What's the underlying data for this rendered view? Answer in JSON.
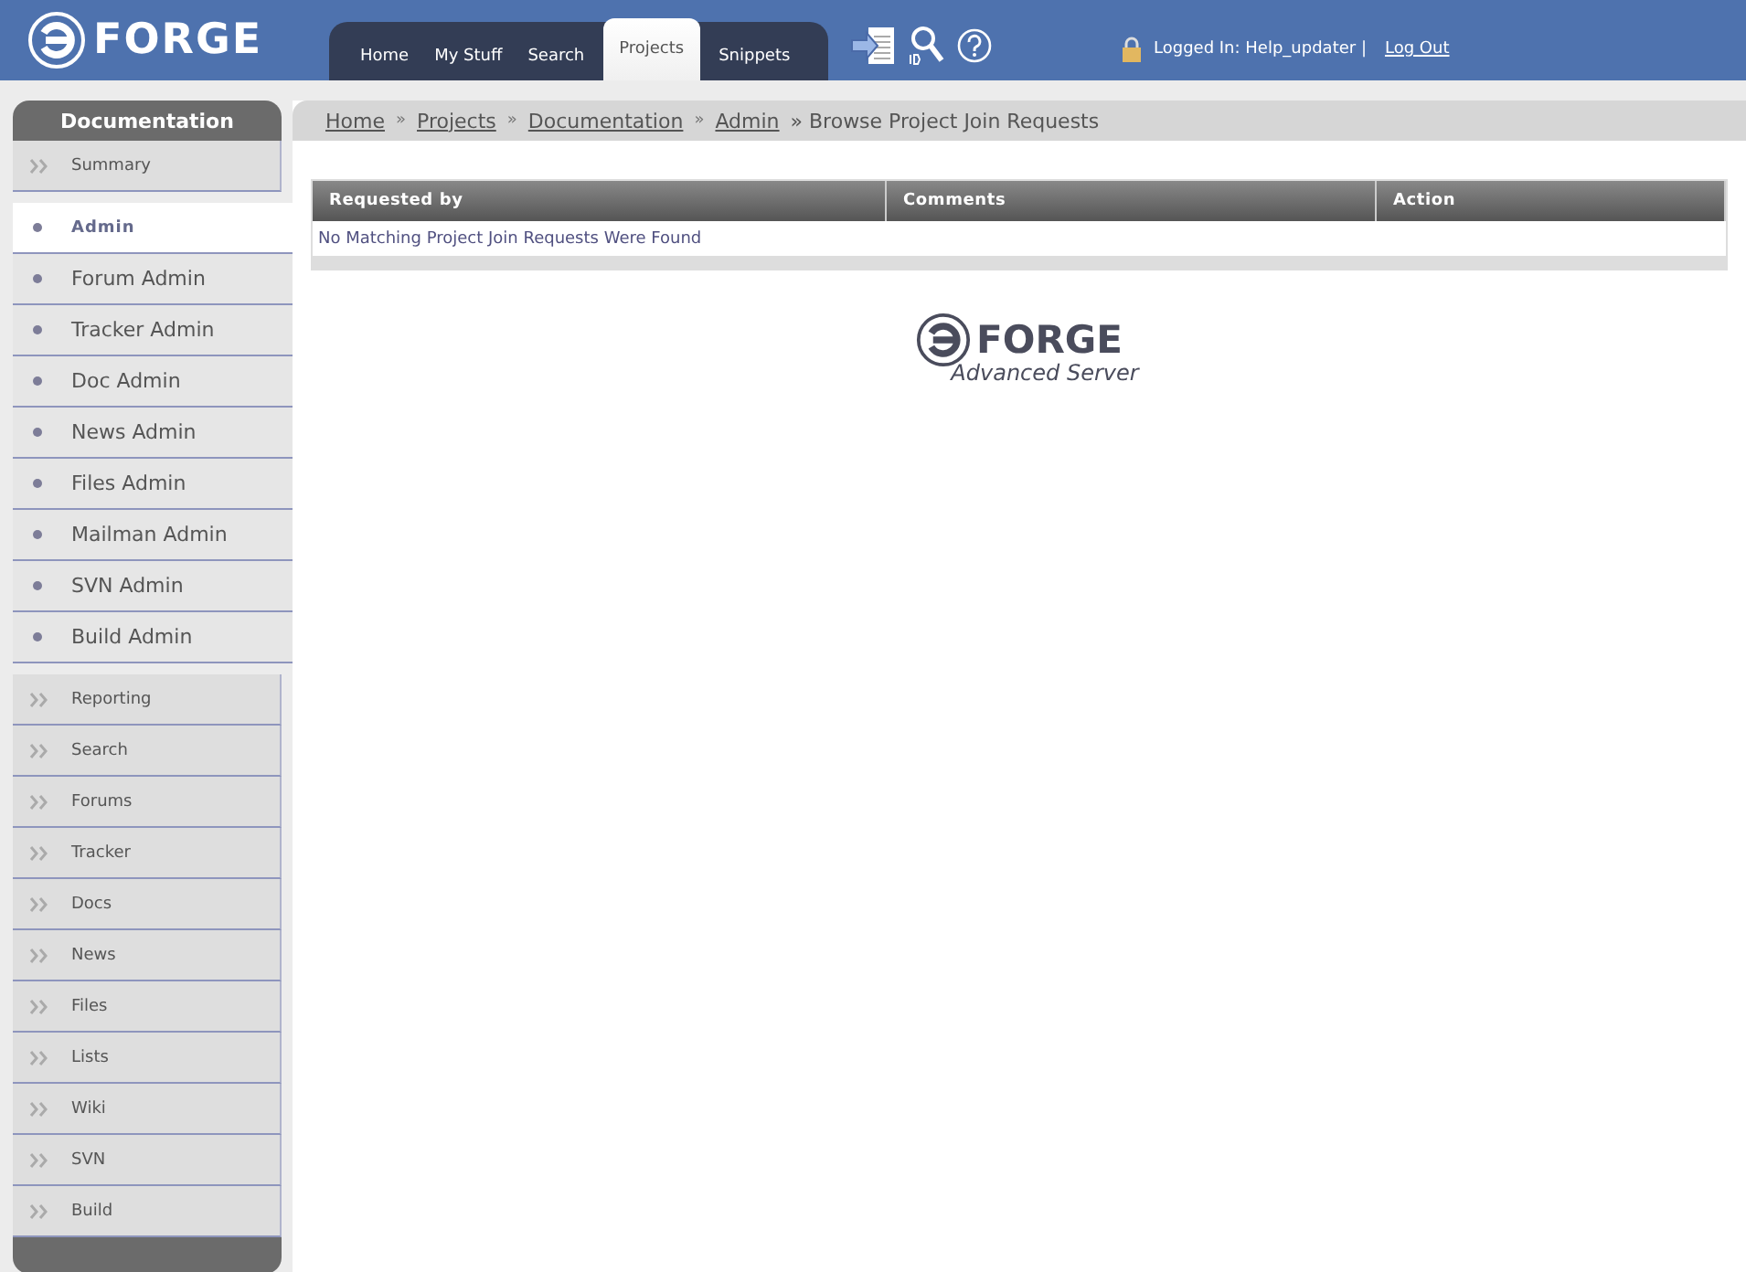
{
  "header": {
    "logo": "FORGE",
    "tabs": [
      {
        "label": "Home",
        "selected": false
      },
      {
        "label": "My Stuff",
        "selected": false
      },
      {
        "label": "Search",
        "selected": false
      },
      {
        "label": "Projects",
        "selected": true
      },
      {
        "label": "Snippets",
        "selected": false
      }
    ],
    "login_text": "Logged In: Help_updater |",
    "logout": "Log Out"
  },
  "sidebar": {
    "title": "Documentation",
    "top_items": [
      {
        "label": "Summary"
      }
    ],
    "admin_items": [
      {
        "label": "Admin",
        "selected": true
      },
      {
        "label": "Forum Admin",
        "selected": false
      },
      {
        "label": "Tracker Admin",
        "selected": false
      },
      {
        "label": "Doc Admin",
        "selected": false
      },
      {
        "label": "News Admin",
        "selected": false
      },
      {
        "label": "Files Admin",
        "selected": false
      },
      {
        "label": "Mailman Admin",
        "selected": false
      },
      {
        "label": "SVN Admin",
        "selected": false
      },
      {
        "label": "Build Admin",
        "selected": false
      }
    ],
    "items": [
      {
        "label": "Reporting"
      },
      {
        "label": "Search"
      },
      {
        "label": "Forums"
      },
      {
        "label": "Tracker"
      },
      {
        "label": "Docs"
      },
      {
        "label": "News"
      },
      {
        "label": "Files"
      },
      {
        "label": "Lists"
      },
      {
        "label": "Wiki"
      },
      {
        "label": "SVN"
      },
      {
        "label": "Build"
      }
    ]
  },
  "breadcrumb": {
    "links": [
      "Home",
      "Projects",
      "Documentation",
      "Admin"
    ],
    "separators": [
      "»",
      "»",
      "»"
    ],
    "current": "» Browse Project Join Requests"
  },
  "table": {
    "columns": [
      "Requested by",
      "Comments",
      "Action"
    ],
    "empty_message": "No Matching Project Join Requests Were Found"
  },
  "footer_logo": {
    "name": "FORGE",
    "subtitle": "Advanced Server"
  }
}
